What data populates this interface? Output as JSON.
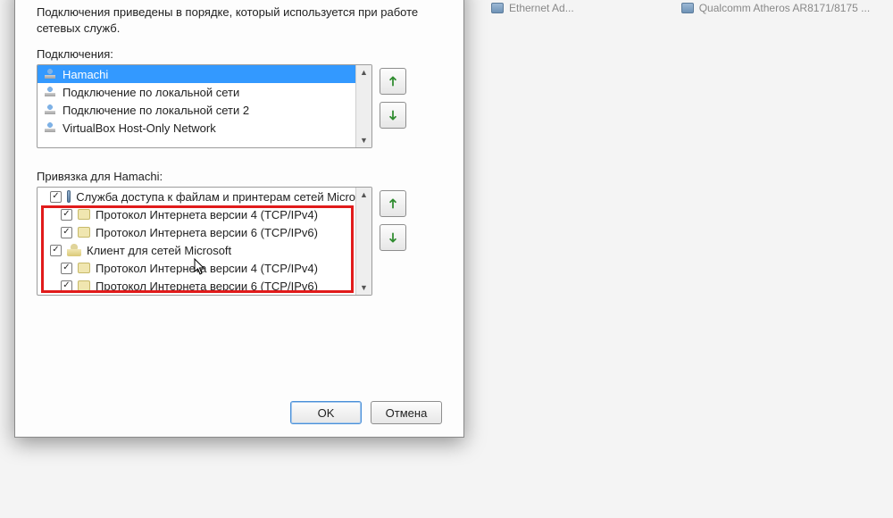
{
  "background": {
    "items": [
      {
        "label": "Ethernet Ad..."
      },
      {
        "label": "Qualcomm Atheros AR8171/8175 ..."
      }
    ]
  },
  "dialog": {
    "intro": "Подключения приведены в порядке, который используется при работе сетевых служб.",
    "connections_label": "Подключения:",
    "bindings_label": "Привязка для Hamachi:",
    "connections": [
      {
        "label": "Hamachi",
        "selected": true
      },
      {
        "label": "Подключение по локальной сети"
      },
      {
        "label": "Подключение по локальной сети 2"
      },
      {
        "label": "VirtualBox Host-Only Network"
      }
    ],
    "bindings": [
      {
        "type": "service",
        "checked": true,
        "label": "Служба доступа к файлам и принтерам сетей Micro"
      },
      {
        "type": "proto",
        "checked": true,
        "label": "Протокол Интернета версии 4 (TCP/IPv4)"
      },
      {
        "type": "proto",
        "checked": true,
        "label": "Протокол Интернета версии 6 (TCP/IPv6)"
      },
      {
        "type": "client",
        "checked": true,
        "label": "Клиент для сетей Microsoft"
      },
      {
        "type": "proto",
        "checked": true,
        "label": "Протокол Интернета версии 4 (TCP/IPv4)"
      },
      {
        "type": "proto",
        "checked": true,
        "label": "Протокол Интернета версии 6 (TCP/IPv6)"
      }
    ],
    "ok_label": "OK",
    "cancel_label": "Отмена"
  }
}
